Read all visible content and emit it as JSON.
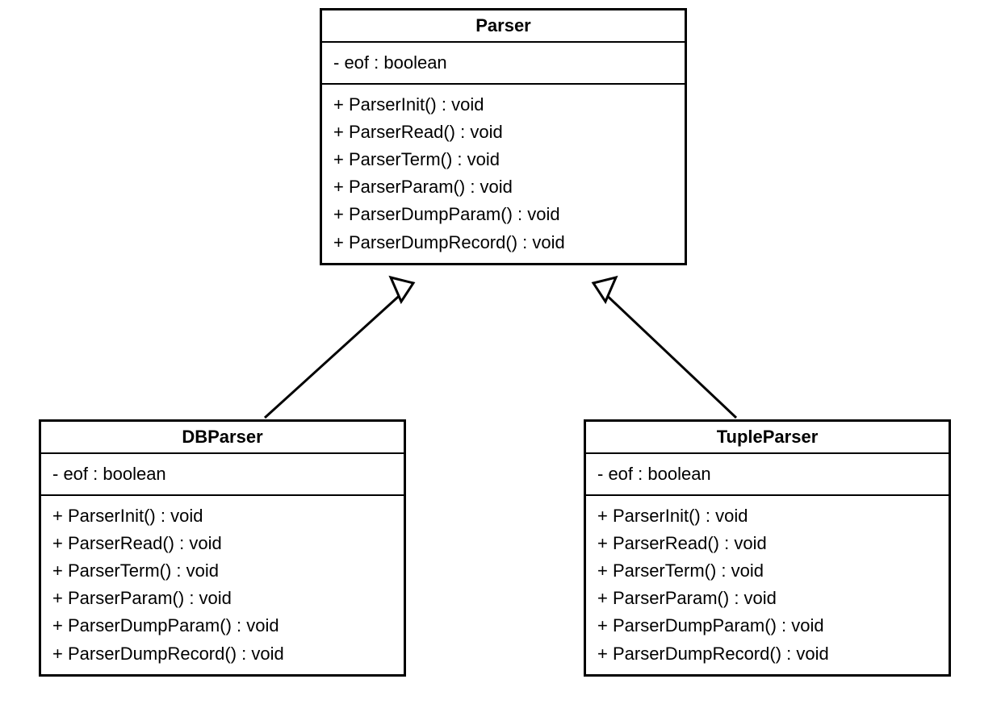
{
  "classes": {
    "parser": {
      "name": "Parser",
      "attributes": [
        "- eof : boolean"
      ],
      "operations": [
        "+ ParserInit() : void",
        "+ ParserRead() : void",
        "+ ParserTerm() : void",
        "+ ParserParam() : void",
        "+ ParserDumpParam() : void",
        "+ ParserDumpRecord() : void"
      ]
    },
    "dbparser": {
      "name": "DBParser",
      "attributes": [
        "- eof : boolean"
      ],
      "operations": [
        "+ ParserInit() : void",
        "+ ParserRead() : void",
        "+ ParserTerm() : void",
        "+ ParserParam() : void",
        "+ ParserDumpParam() : void",
        "+ ParserDumpRecord() : void"
      ]
    },
    "tupleparser": {
      "name": "TupleParser",
      "attributes": [
        "- eof : boolean"
      ],
      "operations": [
        "+ ParserInit() : void",
        "+ ParserRead() : void",
        "+ ParserTerm() : void",
        "+ ParserParam() : void",
        "+ ParserDumpParam() : void",
        "+ ParserDumpRecord() : void"
      ]
    }
  },
  "relations": [
    {
      "type": "generalization",
      "child": "dbparser",
      "parent": "parser"
    },
    {
      "type": "generalization",
      "child": "tupleparser",
      "parent": "parser"
    }
  ]
}
